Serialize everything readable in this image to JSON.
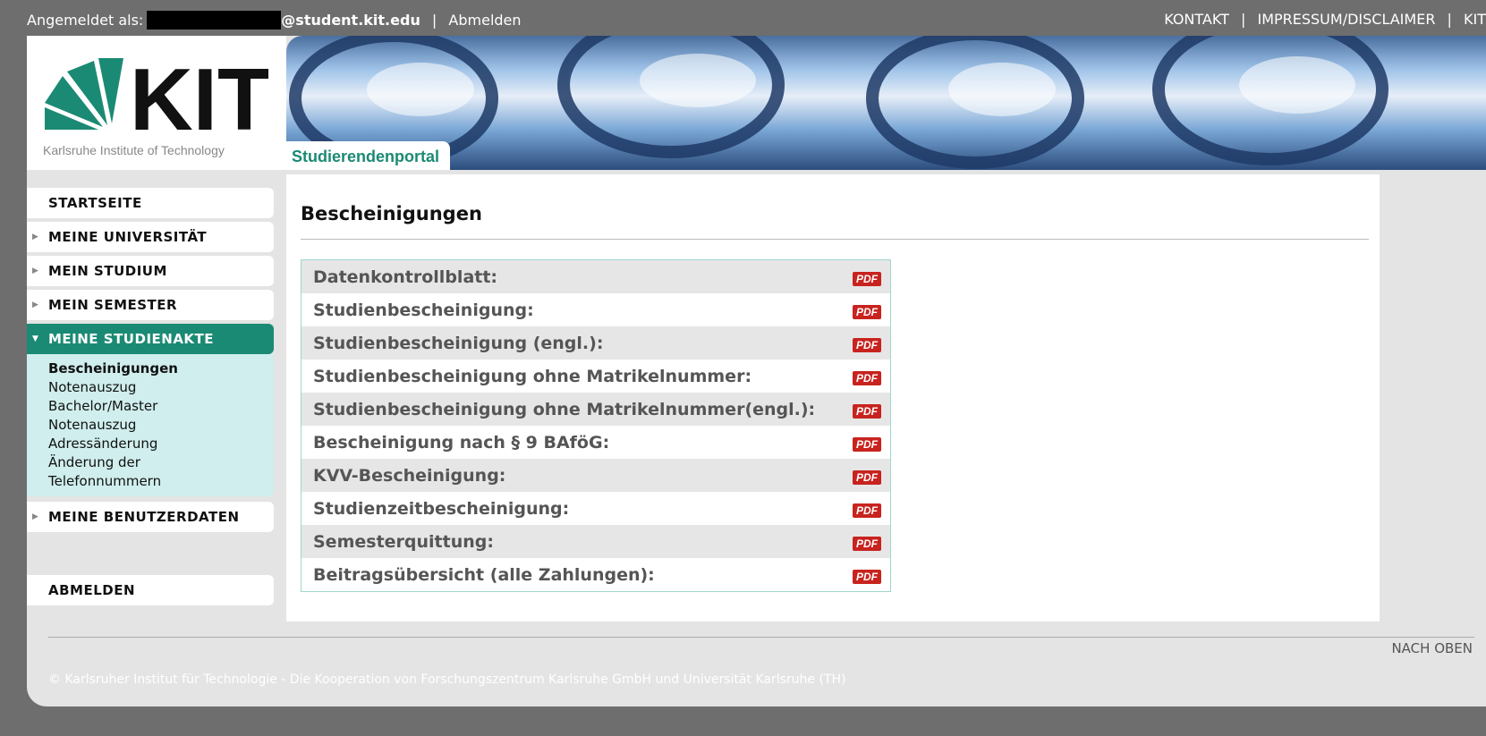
{
  "topbar": {
    "logged_in_label": "Angemeldet als:",
    "email_domain": "@student.kit.edu",
    "logout_link": "Abmelden",
    "links": [
      "KONTAKT",
      "IMPRESSUM/DISCLAIMER",
      "KIT"
    ]
  },
  "header": {
    "logo_text": "KIT",
    "logo_caption": "Karlsruhe Institute of Technology",
    "portal_tab": "Studierendenportal"
  },
  "sidebar": {
    "items": [
      {
        "label": "STARTSEITE"
      },
      {
        "label": "MEINE UNIVERSITÄT"
      },
      {
        "label": "MEIN STUDIUM"
      },
      {
        "label": "MEIN SEMESTER"
      },
      {
        "label": "MEINE STUDIENAKTE"
      },
      {
        "label": "MEINE BENUTZERDATEN"
      },
      {
        "label": "ABMELDEN"
      }
    ],
    "subitems": [
      "Bescheinigungen",
      "Notenauszug",
      "Bachelor/Master",
      "Notenauszug",
      "Adressänderung",
      "Änderung der",
      "Telefonnummern"
    ]
  },
  "main": {
    "title": "Bescheinigungen",
    "pdf_label": "PDF",
    "certificates": [
      "Datenkontrollblatt:",
      "Studienbescheinigung:",
      "Studienbescheinigung (engl.):",
      "Studienbescheinigung ohne Matrikelnummer:",
      "Studienbescheinigung ohne Matrikelnummer(engl.):",
      "Bescheinigung nach § 9 BAföG:",
      "KVV-Bescheinigung:",
      "Studienzeitbescheinigung:",
      "Semesterquittung:",
      "Beitragsübersicht (alle Zahlungen):"
    ]
  },
  "footer": {
    "back_to_top": "NACH OBEN",
    "copyright": "© Karlsruher Institut für Technologie - Die Kooperation von Forschungszentrum Karlsruhe GmbH und Universität Karlsruhe (TH)"
  },
  "colors": {
    "accent": "#1b8a74",
    "subnav_bg": "#cfeeed",
    "pdf_red": "#c8231e"
  }
}
